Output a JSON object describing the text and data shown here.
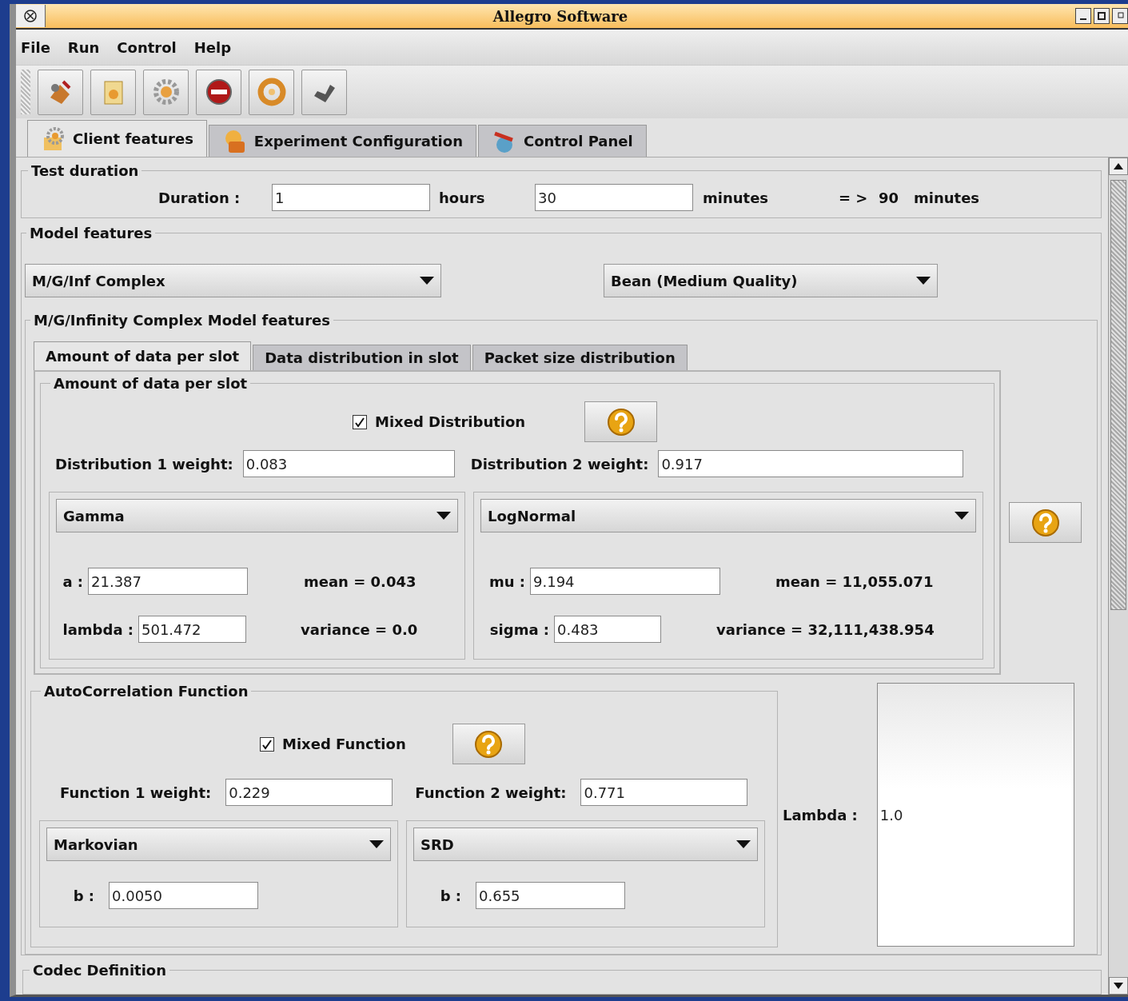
{
  "window": {
    "title": "Allegro Software"
  },
  "menu": [
    "File",
    "Run",
    "Control",
    "Help"
  ],
  "tabs": [
    {
      "label": "Client features",
      "selected": true
    },
    {
      "label": "Experiment Configuration",
      "selected": false
    },
    {
      "label": "Control Panel",
      "selected": false
    }
  ],
  "test_duration": {
    "title": "Test duration",
    "label": "Duration :",
    "hours_value": "1",
    "hours_unit": "hours",
    "minutes_value": "30",
    "minutes_unit": "minutes",
    "arrow": "= >",
    "total": "90",
    "total_unit": "minutes"
  },
  "model_features": {
    "title": "Model features",
    "model_select": "M/G/Inf Complex",
    "quality_select": "Bean (Medium Quality)",
    "complex": {
      "title": "M/G/Infinity Complex Model features",
      "tabs": [
        {
          "label": "Amount of data per slot",
          "selected": true
        },
        {
          "label": "Data distribution in slot",
          "selected": false
        },
        {
          "label": "Packet size distribution",
          "selected": false
        }
      ],
      "slot": {
        "title": "Amount of data per slot",
        "mixed": {
          "label": "Mixed Distribution",
          "checked": true
        },
        "weights": [
          {
            "label": "Distribution 1 weight:",
            "value": "0.083"
          },
          {
            "label": "Distribution 2 weight:",
            "value": "0.917"
          }
        ],
        "distributions": [
          {
            "select": "Gamma",
            "params": [
              {
                "label": "a :",
                "value": "21.387",
                "stat": "mean = 0.043"
              },
              {
                "label": "lambda :",
                "value": "501.472",
                "stat": "variance = 0.0"
              }
            ]
          },
          {
            "select": "LogNormal",
            "params": [
              {
                "label": "mu :",
                "value": "9.194",
                "stat": "mean = 11,055.071"
              },
              {
                "label": "sigma :",
                "value": "0.483",
                "stat": "variance = 32,111,438.954"
              }
            ]
          }
        ]
      },
      "autocorrelation": {
        "title": "AutoCorrelation Function",
        "mixed": {
          "label": "Mixed Function",
          "checked": true
        },
        "weights": [
          {
            "label": "Function 1 weight:",
            "value": "0.229"
          },
          {
            "label": "Function 2 weight:",
            "value": "0.771"
          }
        ],
        "functions": [
          {
            "select": "Markovian",
            "param": {
              "label": "b :",
              "value": "0.0050"
            }
          },
          {
            "select": "SRD",
            "param": {
              "label": "b :",
              "value": "0.655"
            }
          }
        ]
      },
      "lambda": {
        "label": "Lambda :",
        "value": "1.0"
      }
    }
  },
  "codec": {
    "title": "Codec Definition"
  }
}
